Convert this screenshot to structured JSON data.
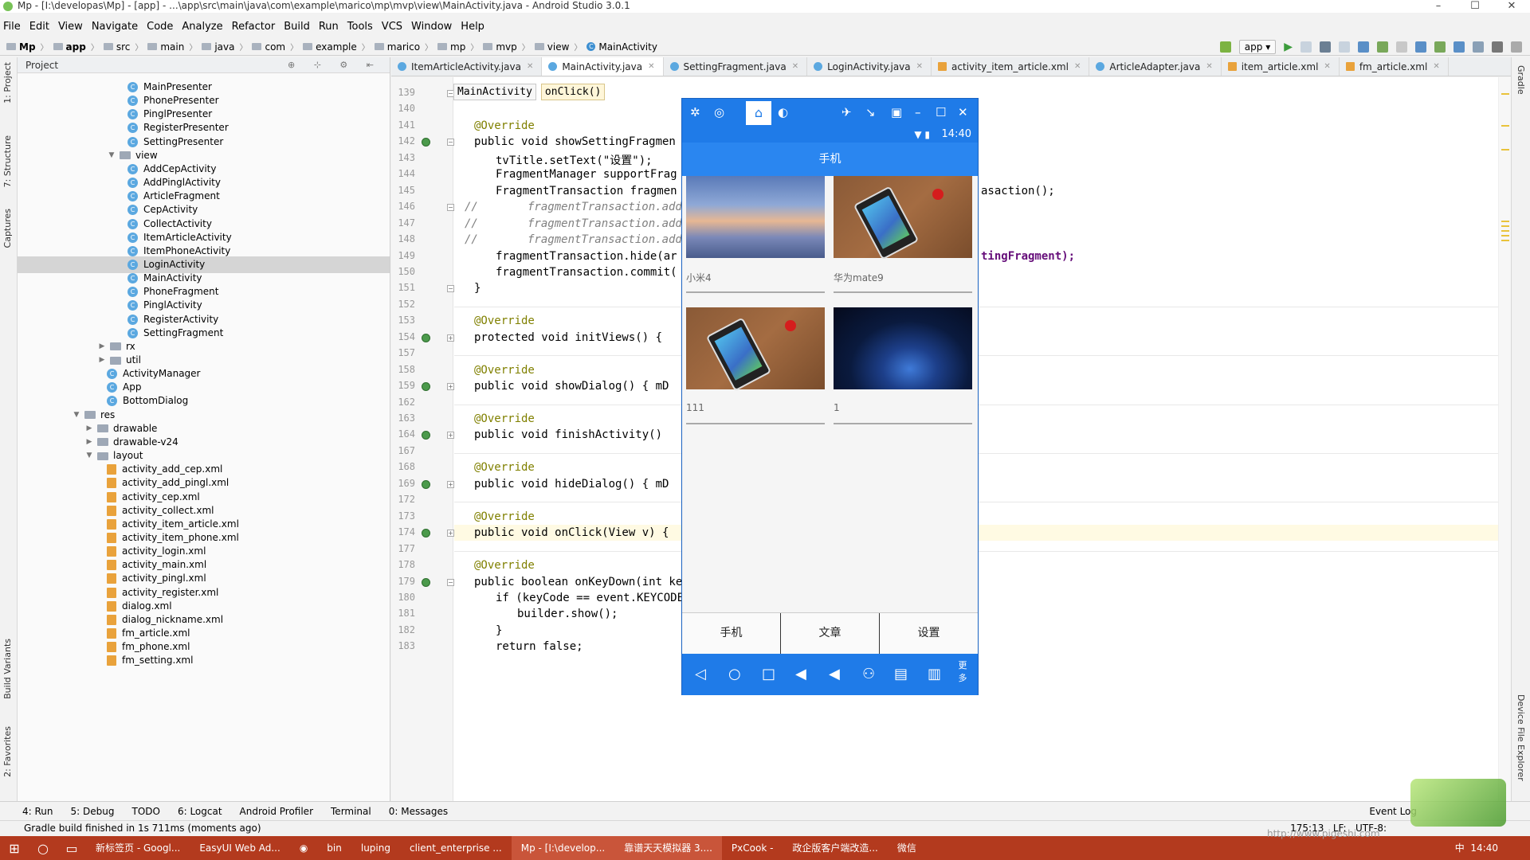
{
  "window": {
    "title": "Mp - [I:\\developas\\Mp] - [app] - ...\\app\\src\\main\\java\\com\\example\\marico\\mp\\mvp\\view\\MainActivity.java - Android Studio 3.0.1"
  },
  "menu": [
    "File",
    "Edit",
    "View",
    "Navigate",
    "Code",
    "Analyze",
    "Refactor",
    "Build",
    "Run",
    "Tools",
    "VCS",
    "Window",
    "Help"
  ],
  "breadcrumbs": [
    "Mp",
    "app",
    "src",
    "main",
    "java",
    "com",
    "example",
    "marico",
    "mp",
    "mvp",
    "view",
    "MainActivity"
  ],
  "toolbar": {
    "config": "app"
  },
  "left_tabs": [
    "1: Project",
    "7: Structure",
    "Captures",
    "Build Variants",
    "2: Favorites"
  ],
  "right_tabs": [
    "Gradle",
    "Device File Explorer"
  ],
  "project": {
    "header": "Project",
    "rows": [
      {
        "label": "MainPresenter",
        "type": "class"
      },
      {
        "label": "PhonePresenter",
        "type": "class"
      },
      {
        "label": "PinglPresenter",
        "type": "class"
      },
      {
        "label": "RegisterPresenter",
        "type": "class"
      },
      {
        "label": "SettingPresenter",
        "type": "class"
      },
      {
        "label": "view",
        "type": "folder-open"
      },
      {
        "label": "AddCepActivity",
        "type": "class"
      },
      {
        "label": "AddPinglActivity",
        "type": "class"
      },
      {
        "label": "ArticleFragment",
        "type": "class"
      },
      {
        "label": "CepActivity",
        "type": "class"
      },
      {
        "label": "CollectActivity",
        "type": "class"
      },
      {
        "label": "ItemArticleActivity",
        "type": "class"
      },
      {
        "label": "ItemPhoneActivity",
        "type": "class"
      },
      {
        "label": "LoginActivity",
        "type": "class",
        "selected": true
      },
      {
        "label": "MainActivity",
        "type": "class"
      },
      {
        "label": "PhoneFragment",
        "type": "class"
      },
      {
        "label": "PinglActivity",
        "type": "class"
      },
      {
        "label": "RegisterActivity",
        "type": "class"
      },
      {
        "label": "SettingFragment",
        "type": "class"
      },
      {
        "label": "rx",
        "type": "folder"
      },
      {
        "label": "util",
        "type": "folder"
      },
      {
        "label": "ActivityManager",
        "type": "class"
      },
      {
        "label": "App",
        "type": "class"
      },
      {
        "label": "BottomDialog",
        "type": "class"
      },
      {
        "label": "res",
        "type": "folder-open"
      },
      {
        "label": "drawable",
        "type": "folder"
      },
      {
        "label": "drawable-v24",
        "type": "folder"
      },
      {
        "label": "layout",
        "type": "folder-open"
      },
      {
        "label": "activity_add_cep.xml",
        "type": "xml"
      },
      {
        "label": "activity_add_pingl.xml",
        "type": "xml"
      },
      {
        "label": "activity_cep.xml",
        "type": "xml"
      },
      {
        "label": "activity_collect.xml",
        "type": "xml"
      },
      {
        "label": "activity_item_article.xml",
        "type": "xml"
      },
      {
        "label": "activity_item_phone.xml",
        "type": "xml"
      },
      {
        "label": "activity_login.xml",
        "type": "xml"
      },
      {
        "label": "activity_main.xml",
        "type": "xml"
      },
      {
        "label": "activity_pingl.xml",
        "type": "xml"
      },
      {
        "label": "activity_register.xml",
        "type": "xml"
      },
      {
        "label": "dialog.xml",
        "type": "xml"
      },
      {
        "label": "dialog_nickname.xml",
        "type": "xml"
      },
      {
        "label": "fm_article.xml",
        "type": "xml"
      },
      {
        "label": "fm_phone.xml",
        "type": "xml"
      },
      {
        "label": "fm_setting.xml",
        "type": "xml"
      }
    ]
  },
  "tabs": [
    {
      "label": "ItemArticleActivity.java",
      "kind": "java"
    },
    {
      "label": "MainActivity.java",
      "kind": "java",
      "active": true
    },
    {
      "label": "SettingFragment.java",
      "kind": "java"
    },
    {
      "label": "LoginActivity.java",
      "kind": "java"
    },
    {
      "label": "activity_item_article.xml",
      "kind": "xml"
    },
    {
      "label": "ArticleAdapter.java",
      "kind": "java"
    },
    {
      "label": "item_article.xml",
      "kind": "xml"
    },
    {
      "label": "fm_article.xml",
      "kind": "xml"
    }
  ],
  "editor_crumbs": [
    "MainActivity",
    "onClick()"
  ],
  "code": {
    "lines": [
      {
        "n": "139",
        "text": "}"
      },
      {
        "n": "140",
        "text": ""
      },
      {
        "n": "141",
        "text": "@Override"
      },
      {
        "n": "142",
        "text": "public void showSettingFragmen"
      },
      {
        "n": "143",
        "text": "tvTitle.setText(\"设置\");"
      },
      {
        "n": "144",
        "text": "FragmentManager supportFrag"
      },
      {
        "n": "145",
        "text": "FragmentTransaction fragmen"
      },
      {
        "n": "146",
        "text": "fragmentTransaction.add(R"
      },
      {
        "n": "147",
        "text": "fragmentTransaction.add(R"
      },
      {
        "n": "148",
        "text": "fragmentTransaction.add(R"
      },
      {
        "n": "149",
        "text": "fragmentTransaction.hide(ar"
      },
      {
        "n": "150",
        "text": "fragmentTransaction.commit("
      },
      {
        "n": "151",
        "text": "}"
      },
      {
        "n": "152",
        "text": ""
      },
      {
        "n": "153",
        "text": "@Override"
      },
      {
        "n": "154",
        "text": "protected void initViews() {"
      },
      {
        "n": "157",
        "text": ""
      },
      {
        "n": "158",
        "text": "@Override"
      },
      {
        "n": "159",
        "text": "public void showDialog() { mD"
      },
      {
        "n": "162",
        "text": ""
      },
      {
        "n": "163",
        "text": "@Override"
      },
      {
        "n": "164",
        "text": "public void finishActivity()"
      },
      {
        "n": "167",
        "text": ""
      },
      {
        "n": "168",
        "text": "@Override"
      },
      {
        "n": "169",
        "text": "public void hideDialog() { mD"
      },
      {
        "n": "172",
        "text": ""
      },
      {
        "n": "173",
        "text": "@Override"
      },
      {
        "n": "174",
        "text": "public void onClick(View v) {"
      },
      {
        "n": "177",
        "text": ""
      },
      {
        "n": "178",
        "text": "@Override"
      },
      {
        "n": "179",
        "text": "public boolean onKeyDown(int keyCode, KeyEvent event) {"
      },
      {
        "n": "180",
        "text": "if (keyCode == event.KEYCODE_BACK) {"
      },
      {
        "n": "181",
        "text": "builder.show();"
      },
      {
        "n": "182",
        "text": "}"
      },
      {
        "n": "183",
        "text": "return false;"
      }
    ],
    "right_fragments": {
      "a": "asaction();",
      "b": "tingFragment);"
    }
  },
  "emulator": {
    "time": "14:40",
    "app_title": "手机",
    "cards": [
      {
        "label": "小米4",
        "image": "sky"
      },
      {
        "label": "华为mate9",
        "image": "phone"
      },
      {
        "label": "111",
        "image": "phone"
      },
      {
        "label": "1",
        "image": "space"
      }
    ],
    "tabs": [
      "手机",
      "文章",
      "设置"
    ],
    "more_label": "更多"
  },
  "bottom_tools": [
    "4: Run",
    "5: Debug",
    "TODO",
    "6: Logcat",
    "Android Profiler",
    "Terminal",
    "0: Messages"
  ],
  "event_log": "Event Log",
  "status": {
    "message": "Gradle build finished in 1s 711ms (moments ago)",
    "position": "175:13",
    "line_sep": "LF:",
    "encoding": "UTF-8:"
  },
  "taskbar": {
    "items": [
      "新标签页 - Googl...",
      "EasyUI Web Ad...",
      "",
      "bin",
      "luping",
      "client_enterprise ...",
      "Mp - [I:\\develop...",
      "靠谱天天模拟器 3....",
      "PxCook -",
      "政企版客户端改造...",
      "微信"
    ],
    "clock": "14:40",
    "ime": "中"
  },
  "watermark": "http://www.pigeshi.com"
}
